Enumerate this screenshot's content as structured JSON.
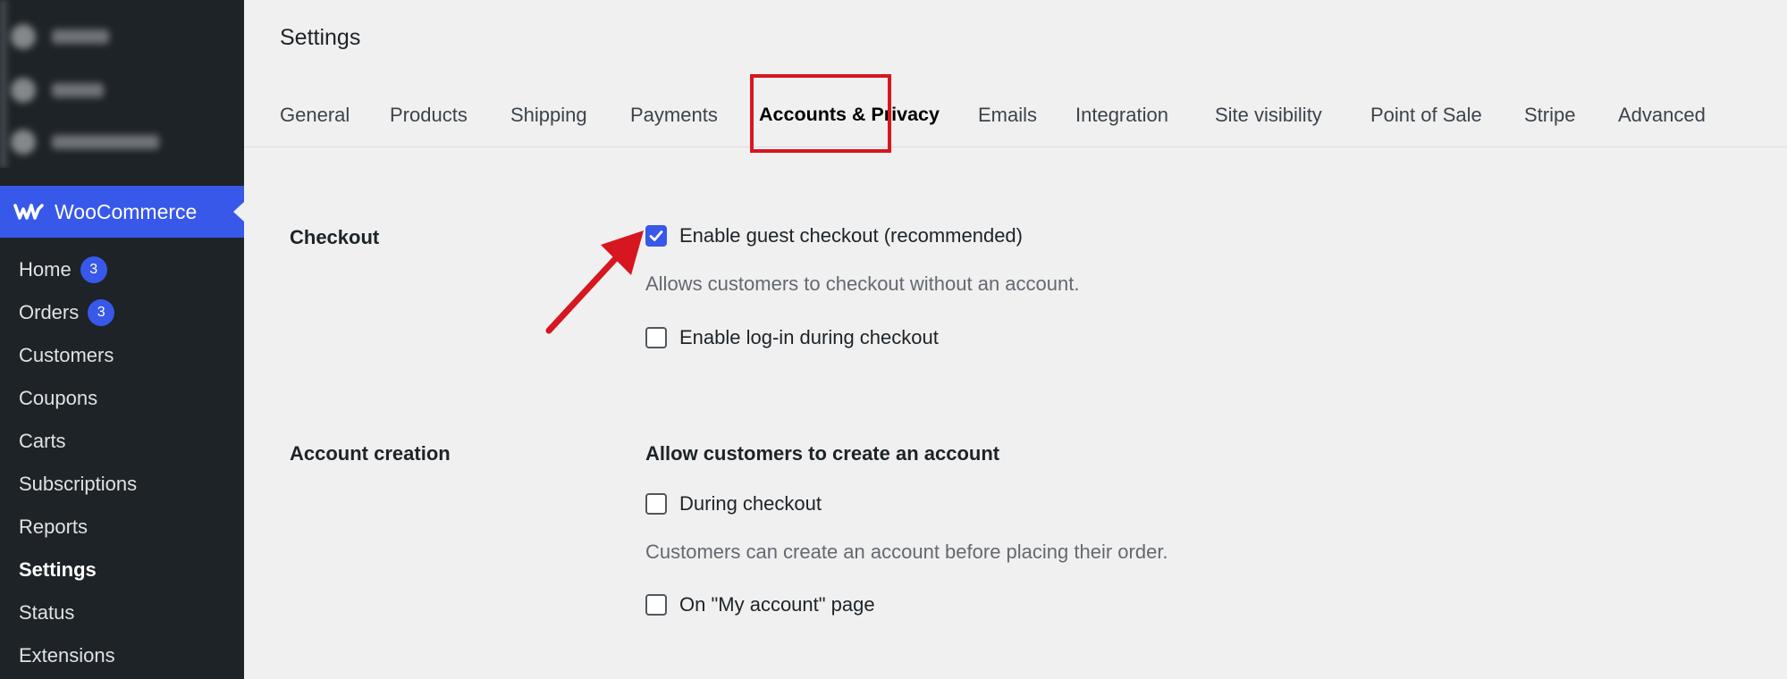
{
  "sidebar": {
    "brand": "WooCommerce",
    "items": [
      {
        "label": "Home",
        "badge": "3"
      },
      {
        "label": "Orders",
        "badge": "3"
      },
      {
        "label": "Customers"
      },
      {
        "label": "Coupons"
      },
      {
        "label": "Carts"
      },
      {
        "label": "Subscriptions"
      },
      {
        "label": "Reports"
      },
      {
        "label": "Settings",
        "current": true
      },
      {
        "label": "Status"
      },
      {
        "label": "Extensions"
      }
    ]
  },
  "page": {
    "title": "Settings"
  },
  "tabs": [
    {
      "label": "General"
    },
    {
      "label": "Products"
    },
    {
      "label": "Shipping"
    },
    {
      "label": "Payments"
    },
    {
      "label": "Accounts & Privacy",
      "active": true
    },
    {
      "label": "Emails"
    },
    {
      "label": "Integration"
    },
    {
      "label": "Site visibility"
    },
    {
      "label": "Point of Sale"
    },
    {
      "label": "Stripe"
    },
    {
      "label": "Advanced"
    }
  ],
  "checkout": {
    "label": "Checkout",
    "guest": {
      "label": "Enable guest checkout (recommended)",
      "checked": true,
      "description": "Allows customers to checkout without an account."
    },
    "login": {
      "label": "Enable log-in during checkout",
      "checked": false
    }
  },
  "account_creation": {
    "label": "Account creation",
    "heading": "Allow customers to create an account",
    "during_checkout": {
      "label": "During checkout",
      "checked": false,
      "description": "Customers can create an account before placing their order."
    },
    "my_account": {
      "label": "On \"My account\" page",
      "checked": false
    }
  },
  "colors": {
    "accent": "#3858e9",
    "sidebar_bg": "#1d2327",
    "highlight": "#d6171f",
    "page_bg": "#f0f0f1"
  },
  "icons": {
    "brand": "woocommerce-logo-icon",
    "annotation": "red-arrow-icon"
  }
}
